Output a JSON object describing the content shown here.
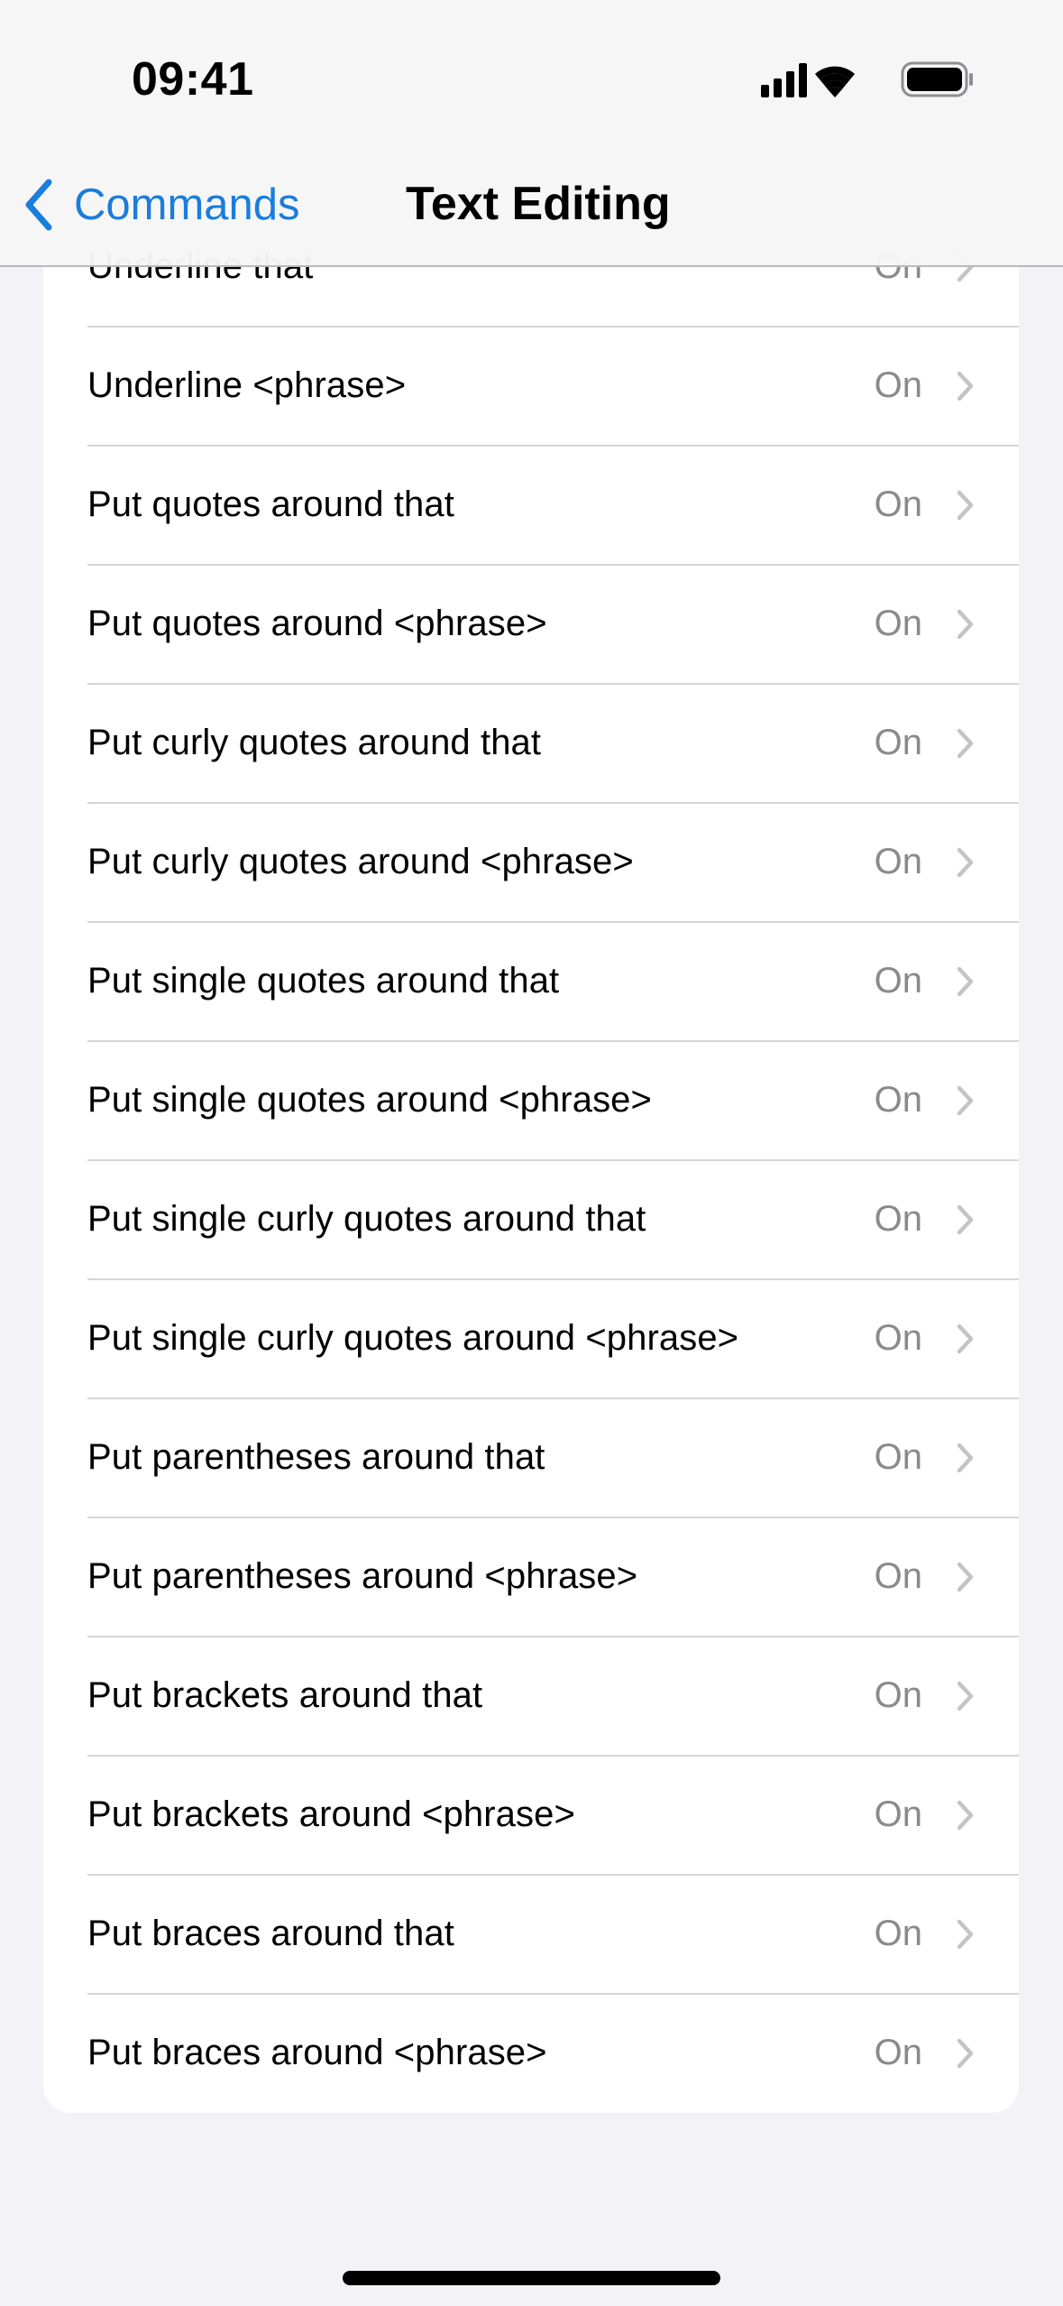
{
  "status_bar": {
    "time": "09:41",
    "icons": [
      "cellular-signal-icon",
      "wifi-icon",
      "battery-icon"
    ]
  },
  "nav": {
    "back_label": "Commands",
    "title": "Text Editing",
    "accent_color": "#1a7ddb"
  },
  "commands": [
    {
      "label": "Underline that",
      "value": "On"
    },
    {
      "label": "Underline <phrase>",
      "value": "On"
    },
    {
      "label": "Put quotes around that",
      "value": "On"
    },
    {
      "label": "Put quotes around <phrase>",
      "value": "On"
    },
    {
      "label": "Put curly quotes around that",
      "value": "On"
    },
    {
      "label": "Put curly quotes around <phrase>",
      "value": "On"
    },
    {
      "label": "Put single quotes around that",
      "value": "On"
    },
    {
      "label": "Put single quotes around <phrase>",
      "value": "On"
    },
    {
      "label": "Put single curly quotes around that",
      "value": "On"
    },
    {
      "label": "Put single curly quotes around <phrase>",
      "value": "On"
    },
    {
      "label": "Put parentheses around that",
      "value": "On"
    },
    {
      "label": "Put parentheses around <phrase>",
      "value": "On"
    },
    {
      "label": "Put brackets around that",
      "value": "On"
    },
    {
      "label": "Put brackets around <phrase>",
      "value": "On"
    },
    {
      "label": "Put braces around that",
      "value": "On"
    },
    {
      "label": "Put braces around <phrase>",
      "value": "On"
    }
  ]
}
